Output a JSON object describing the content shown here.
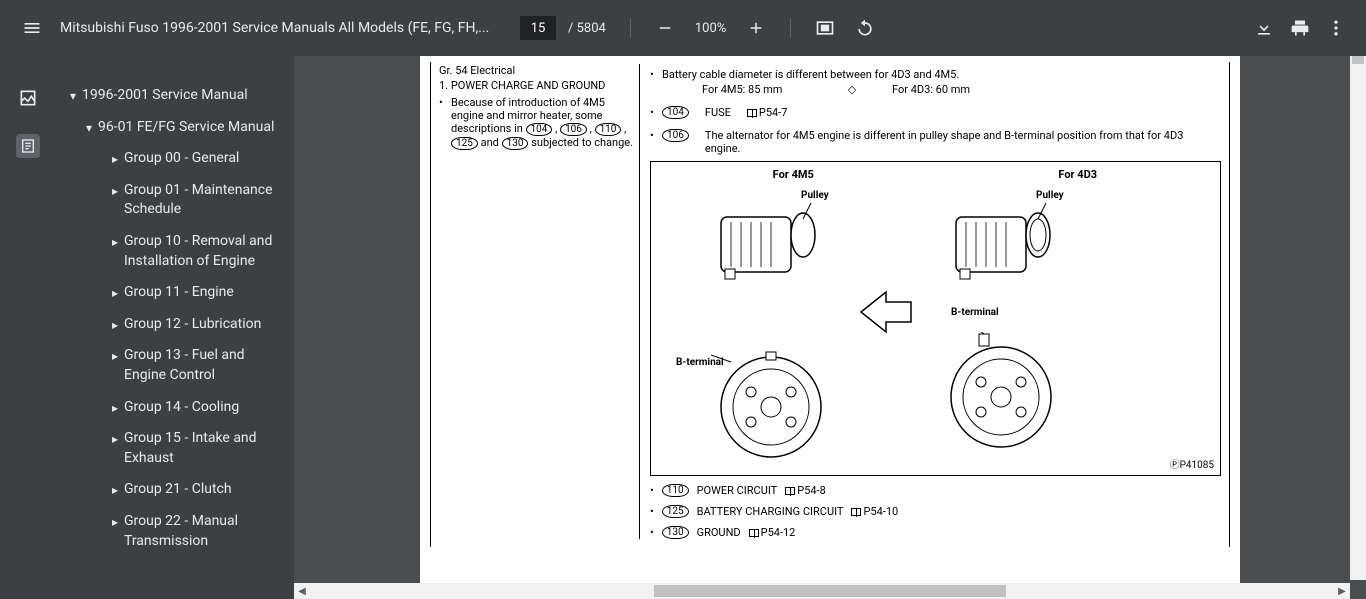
{
  "toolbar": {
    "title": "Mitsubishi Fuso 1996-2001 Service Manuals All Models (FE, FG, FH,...",
    "page_current": "15",
    "page_total": "/ 5804",
    "zoom": "100%"
  },
  "outline": {
    "root": "1996-2001 Service Manual",
    "sub": "96-01 FE/FG Service Manual",
    "items": [
      "Group 00 - General",
      "Group 01 - Maintenance Schedule",
      "Group 10 - Removal and Installation of Engine",
      "Group 11 - Engine",
      "Group 12 - Lubrication",
      "Group 13 - Fuel and Engine Control",
      "Group 14 - Cooling",
      "Group 15 - Intake and Exhaust",
      "Group 21 - Clutch",
      "Group 22 - Manual Transmission"
    ]
  },
  "doc": {
    "section": "Gr. 54 Electrical",
    "list_num": "1.",
    "list_title": "POWER CHARGE AND GROUND",
    "left_body1": "Because of introduction of 4M5 engine and mirror heater, some descriptions in ",
    "refs_inline": [
      "104",
      "106",
      "110",
      "125",
      "130"
    ],
    "left_body2": " subjected to change.",
    "right_line1": "Battery cable diameter is different between for 4D3 and 4M5.",
    "right_l2a": "For 4M5: 85 mm",
    "right_l2b": "For 4D3: 60 mm",
    "ref104": "104",
    "fuse": "FUSE",
    "p54_7": "P54-7",
    "ref106": "106",
    "alt_desc": "The alternator for 4M5 engine is different in pulley shape and B-terminal position from that for 4D3 engine.",
    "for4m5": "For 4M5",
    "for4d3": "For 4D3",
    "pulley": "Pulley",
    "bterm": "B-terminal",
    "pcode": "P41085",
    "ref110": "110",
    "power_circuit": "POWER CIRCUIT",
    "p54_8": "P54-8",
    "ref125": "125",
    "batt_charge": "BATTERY CHARGING CIRCUIT",
    "p54_10": "P54-10",
    "ref130": "130",
    "ground": "GROUND",
    "p54_12": "P54-12",
    "and": " and "
  }
}
